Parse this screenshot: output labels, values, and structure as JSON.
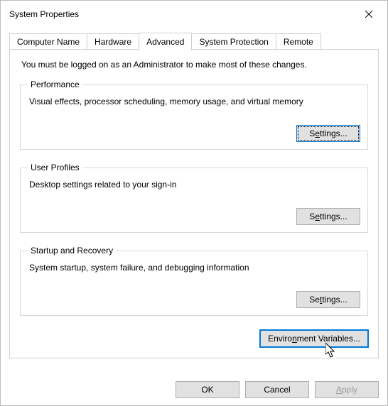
{
  "window": {
    "title": "System Properties"
  },
  "tabs": {
    "computer_name": "Computer Name",
    "hardware": "Hardware",
    "advanced": "Advanced",
    "system_protection": "System Protection",
    "remote": "Remote"
  },
  "advanced_tab": {
    "admin_note": "You must be logged on as an Administrator to make most of these changes.",
    "performance": {
      "legend": "Performance",
      "desc": "Visual effects, processor scheduling, memory usage, and virtual memory",
      "settings_pre": "S",
      "settings_u": "e",
      "settings_post": "ttings..."
    },
    "user_profiles": {
      "legend": "User Profiles",
      "desc": "Desktop settings related to your sign-in",
      "settings_pre": "S",
      "settings_u": "e",
      "settings_post": "ttings..."
    },
    "startup_recovery": {
      "legend": "Startup and Recovery",
      "desc": "System startup, system failure, and debugging information",
      "settings_pre": "Se",
      "settings_u": "t",
      "settings_post": "tings..."
    },
    "env_vars": {
      "pre": "Enviro",
      "u": "n",
      "post": "ment Variables..."
    }
  },
  "dialog_buttons": {
    "ok": "OK",
    "cancel": "Cancel",
    "apply_u": "A",
    "apply_post": "pply"
  }
}
